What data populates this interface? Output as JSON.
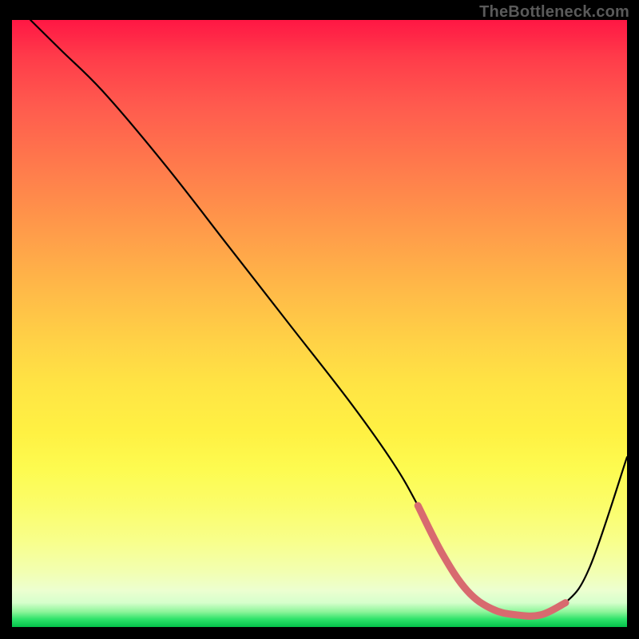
{
  "watermark": "TheBottleneck.com",
  "chart_data": {
    "type": "line",
    "title": "",
    "xlabel": "",
    "ylabel": "",
    "xlim": [
      0,
      100
    ],
    "ylim": [
      0,
      100
    ],
    "grid": false,
    "legend": false,
    "series": [
      {
        "name": "curve",
        "x": [
          3,
          8,
          15,
          25,
          35,
          45,
          55,
          62,
          66,
          70,
          74,
          78,
          82,
          86,
          90,
          94,
          100
        ],
        "y": [
          100,
          95,
          88,
          76,
          63,
          50,
          37,
          27,
          20,
          12,
          6,
          3,
          2,
          2,
          4,
          10,
          28
        ]
      }
    ],
    "highlight_range": {
      "note": "pink highlighted segment near trough",
      "x": [
        66,
        70,
        74,
        78,
        82,
        86,
        90
      ],
      "y": [
        20,
        12,
        6,
        3,
        2,
        2,
        4
      ]
    },
    "background_gradient": {
      "top": "#ff1744",
      "mid": "#ffe444",
      "bottom": "#04c24a"
    }
  }
}
